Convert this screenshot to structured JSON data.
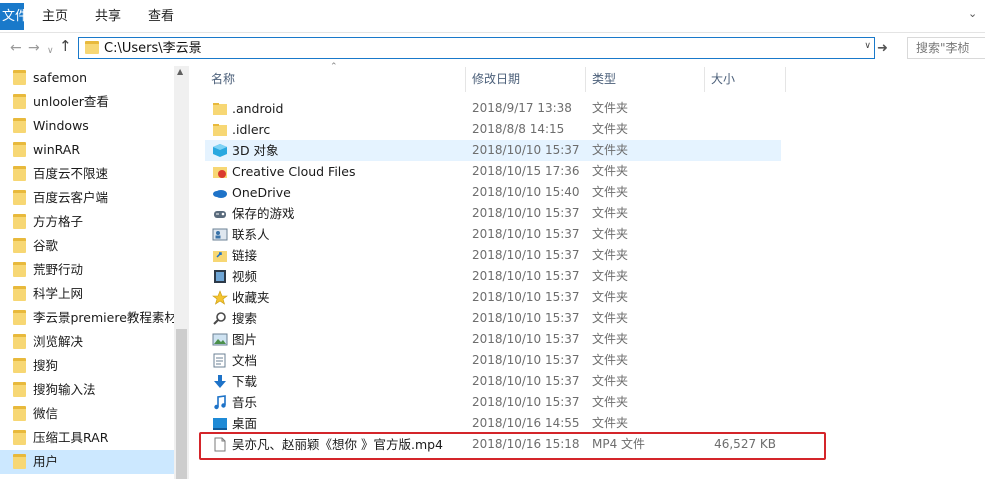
{
  "ribbon": {
    "file_tab": "文件",
    "tabs": [
      "主页",
      "共享",
      "查看"
    ]
  },
  "address": {
    "path": "C:\\Users\\李云景",
    "search_placeholder": "搜索\"李桢"
  },
  "nav_pane": {
    "items": [
      {
        "label": "safemon"
      },
      {
        "label": "unlooler查看"
      },
      {
        "label": "Windows"
      },
      {
        "label": "winRAR"
      },
      {
        "label": "百度云不限速"
      },
      {
        "label": "百度云客户端"
      },
      {
        "label": "方方格子"
      },
      {
        "label": "谷歌"
      },
      {
        "label": "荒野行动"
      },
      {
        "label": "科学上网"
      },
      {
        "label": "李云景premiere教程素材"
      },
      {
        "label": "浏览解决"
      },
      {
        "label": "搜狗"
      },
      {
        "label": "搜狗输入法"
      },
      {
        "label": "微信"
      },
      {
        "label": "压缩工具RAR"
      },
      {
        "label": "用户"
      }
    ],
    "selected_index": 16
  },
  "columns": {
    "name": "名称",
    "date": "修改日期",
    "type": "类型",
    "size": "大小"
  },
  "files": [
    {
      "name": ".android",
      "date": "2018/9/17 13:38",
      "type": "文件夹",
      "size": "",
      "icon": "folder-icon"
    },
    {
      "name": ".idlerc",
      "date": "2018/8/8 14:15",
      "type": "文件夹",
      "size": "",
      "icon": "folder-icon"
    },
    {
      "name": "3D 对象",
      "date": "2018/10/10 15:37",
      "type": "文件夹",
      "size": "",
      "icon": "3d-objects-icon"
    },
    {
      "name": "Creative Cloud Files",
      "date": "2018/10/15 17:36",
      "type": "文件夹",
      "size": "",
      "icon": "creative-cloud-icon"
    },
    {
      "name": "OneDrive",
      "date": "2018/10/10 15:40",
      "type": "文件夹",
      "size": "",
      "icon": "onedrive-icon"
    },
    {
      "name": "保存的游戏",
      "date": "2018/10/10 15:37",
      "type": "文件夹",
      "size": "",
      "icon": "saved-games-icon"
    },
    {
      "name": "联系人",
      "date": "2018/10/10 15:37",
      "type": "文件夹",
      "size": "",
      "icon": "contacts-icon"
    },
    {
      "name": "链接",
      "date": "2018/10/10 15:37",
      "type": "文件夹",
      "size": "",
      "icon": "links-icon"
    },
    {
      "name": "视频",
      "date": "2018/10/10 15:37",
      "type": "文件夹",
      "size": "",
      "icon": "videos-icon"
    },
    {
      "name": "收藏夹",
      "date": "2018/10/10 15:37",
      "type": "文件夹",
      "size": "",
      "icon": "favorites-icon"
    },
    {
      "name": "搜索",
      "date": "2018/10/10 15:37",
      "type": "文件夹",
      "size": "",
      "icon": "searches-icon"
    },
    {
      "name": "图片",
      "date": "2018/10/10 15:37",
      "type": "文件夹",
      "size": "",
      "icon": "pictures-icon"
    },
    {
      "name": "文档",
      "date": "2018/10/10 15:37",
      "type": "文件夹",
      "size": "",
      "icon": "documents-icon"
    },
    {
      "name": "下载",
      "date": "2018/10/10 15:37",
      "type": "文件夹",
      "size": "",
      "icon": "downloads-icon"
    },
    {
      "name": "音乐",
      "date": "2018/10/10 15:37",
      "type": "文件夹",
      "size": "",
      "icon": "music-icon"
    },
    {
      "name": "桌面",
      "date": "2018/10/16 14:55",
      "type": "文件夹",
      "size": "",
      "icon": "desktop-icon"
    },
    {
      "name": "吴亦凡、赵丽颖《想你 》官方版.mp4",
      "date": "2018/10/16 15:18",
      "type": "MP4 文件",
      "size": "46,527 KB",
      "icon": "file-icon"
    }
  ],
  "highlighted_index": 2,
  "colors": {
    "accent": "#1979ca",
    "selection": "#cce8ff",
    "hover": "#e5f3ff",
    "annotation_box": "#d4252a",
    "folder": "#f7d774"
  }
}
